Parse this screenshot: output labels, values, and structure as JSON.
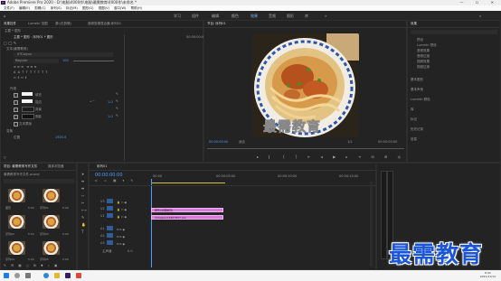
{
  "window": {
    "title": "Adobe Premiere Pro 2020 - D:\\电脑\\4000作\\电脑\\最需教育\\4000作\\未命名 *"
  },
  "menu": [
    "文件(F)",
    "编辑(E)",
    "剪辑(C)",
    "序列(S)",
    "标记(M)",
    "图形(G)",
    "视图(V)",
    "窗口(W)",
    "帮助(H)"
  ],
  "workspace_tabs": [
    "学习",
    "组件",
    "编辑",
    "颜色",
    "效果",
    "音频",
    "图形",
    "库"
  ],
  "active_workspace": "效果",
  "effects_controls": {
    "tabs": [
      "效果控件",
      "Lumetri 范围",
      "源:(无剪辑)",
      "音频剪辑混合器:序列01"
    ],
    "clip_header": "主要 * 图形 · 序列01 * 图形",
    "source_label": "主要 * 图形",
    "section_text": "文本(最需教育)",
    "font": "STCaiyun",
    "style": "Regular",
    "size": "100",
    "appearance_label": "外观",
    "fill_label": "填充",
    "stroke_label": "描边",
    "background_label": "背景",
    "shadow_label": "阴影",
    "stroke_value": "1.0",
    "shadow_value": "1.0",
    "mask_label": "文本蒙版",
    "transform_label": "变换",
    "position_label": "位置",
    "position_value": "1920.0",
    "timecode": "00:00:00:00"
  },
  "program": {
    "tab": "节目: 序列01",
    "timecode": "00:00:00:00",
    "fit": "适合",
    "ratio": "1/2",
    "duration": "00:00:05:00",
    "overlay_text": "最需教育"
  },
  "project": {
    "tabs": [
      "项目: 最需教育写作文件",
      "媒体浏览器"
    ],
    "filename": "最需教育写作文件.prproj",
    "items": [
      {
        "name": "图形",
        "dur": "5:00"
      },
      {
        "name": "序列01",
        "dur": "5:00"
      },
      {
        "name": "序列02",
        "dur": "5:00"
      },
      {
        "name": "序列03",
        "dur": "5:00"
      },
      {
        "name": "序列04",
        "dur": "5:00"
      },
      {
        "name": "序列05",
        "dur": "5:00"
      }
    ]
  },
  "timeline": {
    "tab": "序列01",
    "timecode": "00:00:00:00",
    "ruler": [
      "00:00",
      "00:00:05:00",
      "00:00:10:00",
      "00:00:15:00"
    ],
    "tracks_v": [
      "V3",
      "V2",
      "V1"
    ],
    "tracks_a": [
      "A1",
      "A2",
      "A3"
    ],
    "master": "主声道",
    "master_value": "0.0",
    "clip_title": "图形(最需教育)",
    "clip_image": "mmexport1607657.jpg"
  },
  "effects_panel": {
    "title": "效果",
    "items": [
      "预设",
      "Lumetri 预设",
      "音频效果",
      "音频过渡",
      "视频效果",
      "视频过渡"
    ],
    "sections": [
      "基本图形",
      "基本声音",
      "Lumetri 颜色",
      "库",
      "标记",
      "历史记录",
      "信息"
    ]
  },
  "taskbar": {
    "time": "8:43",
    "date": "2021/11/12"
  },
  "watermark": "最需教育"
}
